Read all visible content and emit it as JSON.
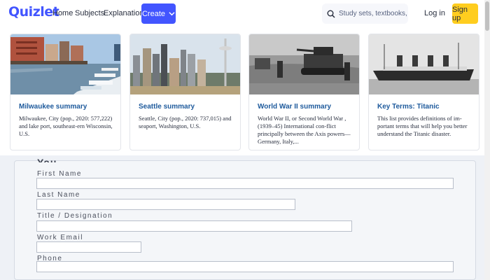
{
  "header": {
    "logo": "Quizlet",
    "nav": {
      "home": "Home",
      "subjects": "Subjects",
      "explanations": "Explanations"
    },
    "create_label": "Create",
    "search_placeholder": "Study sets, textbooks, ...",
    "login_label": "Log in",
    "signup_label": "Sign up"
  },
  "cards": [
    {
      "title": "Milwaukee summary",
      "description": "Milwaukee, City (pop., 2020: 577,222) and lake port, southeast-ern Wisconsin, U.S.",
      "image": "milwaukee-waterfront-photo"
    },
    {
      "title": "Seattle summary",
      "description": "Seattle, City (pop., 2020: 737,015) and seaport, Washington, U.S.",
      "image": "seattle-skyline-photo"
    },
    {
      "title": "World War II summary",
      "description": "World War II, or Second World War , (1939–45) International con-flict principally between the Axis powers—Germany, Italy,...",
      "image": "ww2-tanks-photo"
    },
    {
      "title": "Key Terms: Titanic",
      "description": "This list provides definitions of im-portant terms that will help you better understand the Titanic disaster.",
      "image": "titanic-ship-photo"
    }
  ],
  "form": {
    "title": "You",
    "fields": [
      {
        "label": "First Name",
        "value": ""
      },
      {
        "label": "Last Name",
        "value": ""
      },
      {
        "label": "Title / Designation",
        "value": ""
      },
      {
        "label": "Work Email",
        "value": ""
      },
      {
        "label": "Phone",
        "value": ""
      }
    ]
  },
  "colors": {
    "brand": "#4255ff",
    "signup": "#ffcd1f",
    "card_title": "#1e5a9c"
  }
}
